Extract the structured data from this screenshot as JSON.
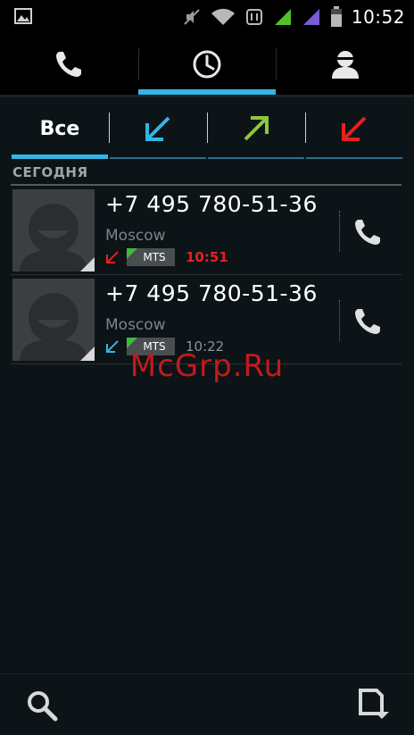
{
  "status_bar": {
    "time": "10:52",
    "icons": [
      "gallery-notification-icon",
      "mute-icon",
      "wifi-icon",
      "data-transfer-icon",
      "signal-sim1-icon",
      "signal-sim2-icon",
      "battery-icon"
    ]
  },
  "top_tabs": [
    {
      "name": "phone",
      "icon": "phone-icon",
      "active": false
    },
    {
      "name": "call-log",
      "icon": "clock-icon",
      "active": true
    },
    {
      "name": "contacts",
      "icon": "person-icon",
      "active": false
    }
  ],
  "filter_tabs": [
    {
      "label": "Все",
      "active": true
    },
    {
      "icon": "incoming-call-icon",
      "color": "#33b5e5"
    },
    {
      "icon": "outgoing-call-icon",
      "color": "#8ec63f"
    },
    {
      "icon": "missed-call-icon",
      "color": "#e8201e"
    }
  ],
  "section": {
    "header": "СЕГОДНЯ"
  },
  "calls": [
    {
      "number": "+7 495 780-51-36",
      "location": "Moscow",
      "type": "missed",
      "type_color": "#e8201e",
      "operator": "MTS",
      "time": "10:51",
      "time_color": "#e8201e"
    },
    {
      "number": "+7 495 780-51-36",
      "location": "Moscow",
      "type": "incoming",
      "type_color": "#33b5e5",
      "operator": "MTS",
      "time": "10:22",
      "time_color": "#8d9497"
    }
  ],
  "bottom_bar": {
    "left_icon": "search-icon",
    "right_icon": "menu-overflow-icon"
  },
  "watermark": "McGrp.Ru",
  "colors": {
    "accent": "#33b5e5",
    "background": "#0c1418",
    "missed": "#e8201e",
    "outgoing": "#8ec63f"
  }
}
